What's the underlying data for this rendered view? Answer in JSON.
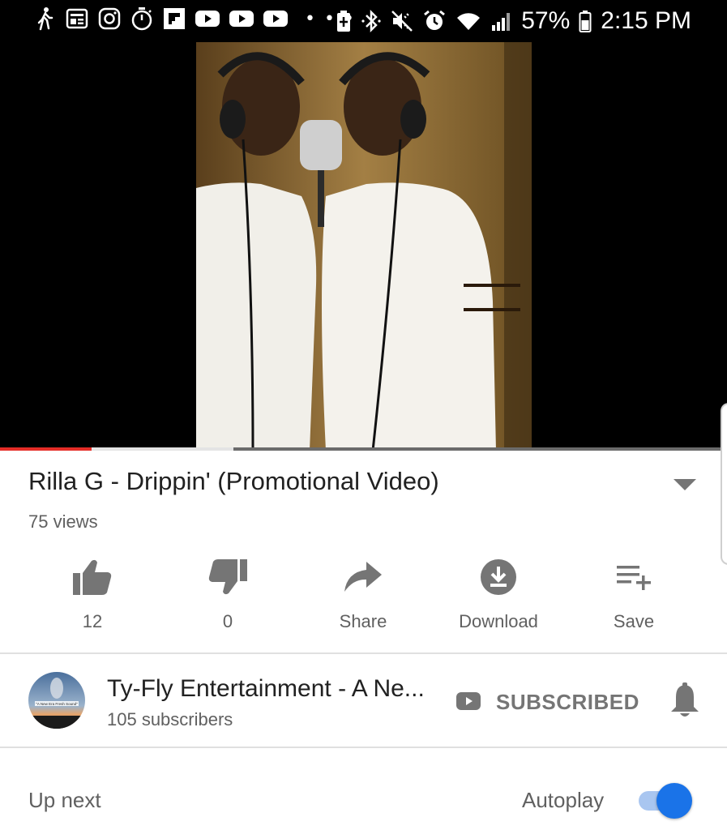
{
  "status_bar": {
    "left_icons": [
      "walking-icon",
      "news-icon",
      "instagram-icon",
      "stopwatch-icon",
      "flipboard-icon",
      "youtube-icon",
      "youtube-icon",
      "youtube-icon"
    ],
    "more_indicator": "• • •",
    "right_icons": [
      "battery-saver-icon",
      "bluetooth-icon",
      "mute-icon",
      "alarm-icon",
      "wifi-icon",
      "signal-icon"
    ],
    "battery_percent": "57%",
    "time": "2:15 PM"
  },
  "video": {
    "progress": 0.127,
    "buffered": 0.324,
    "colors": {
      "played": "#e52d27",
      "buffered": "#e4e4e4",
      "track": "#6b6b6b"
    }
  },
  "title": "Rilla G - Drippin' (Promotional Video)",
  "views": "75 views",
  "actions": {
    "like": {
      "icon": "thumbs-up-icon",
      "label": "12"
    },
    "dislike": {
      "icon": "thumbs-down-icon",
      "label": "0"
    },
    "share": {
      "icon": "share-icon",
      "label": "Share"
    },
    "download": {
      "icon": "download-icon",
      "label": "Download"
    },
    "save": {
      "icon": "playlist-add-icon",
      "label": "Save"
    }
  },
  "channel": {
    "name": "Ty-Fly Entertainment - A Ne...",
    "subscribers": "105 subscribers",
    "subscribe_label": "SUBSCRIBED",
    "avatar_caption": "\"A New Era Fresh Sound\""
  },
  "up_next": {
    "label": "Up next",
    "autoplay_label": "Autoplay",
    "autoplay_on": true,
    "accent": "#1a73e8"
  }
}
